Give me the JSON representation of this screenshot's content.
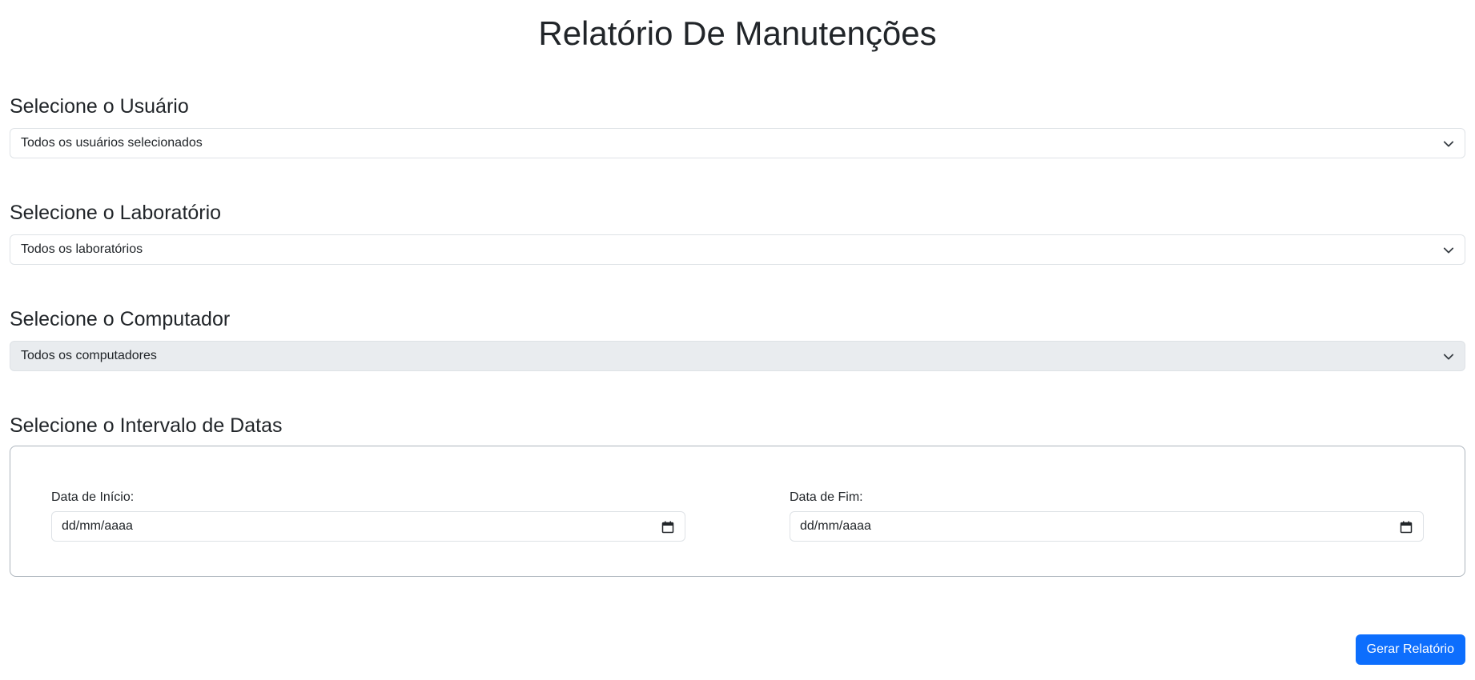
{
  "page": {
    "title": "Relatório De Manutenções"
  },
  "user_section": {
    "label": "Selecione o Usuário",
    "selected": "Todos os usuários selecionados"
  },
  "lab_section": {
    "label": "Selecione o Laboratório",
    "selected": "Todos os laboratórios"
  },
  "computer_section": {
    "label": "Selecione o Computador",
    "selected": "Todos os computadores",
    "disabled": true
  },
  "date_section": {
    "label": "Selecione o Intervalo de Datas",
    "start_label": "Data de Início:",
    "start_value": "dd/mm/aaaa",
    "end_label": "Data de Fim:",
    "end_value": "dd/mm/aaaa"
  },
  "actions": {
    "generate_label": "Gerar Relatório"
  },
  "colors": {
    "primary": "#0d6efd",
    "disabled_bg": "#e9ecef",
    "border": "#dee2e6",
    "text": "#212529"
  },
  "icons": {
    "select_chevron": "chevron-down-icon",
    "date_picker": "calendar-icon"
  }
}
